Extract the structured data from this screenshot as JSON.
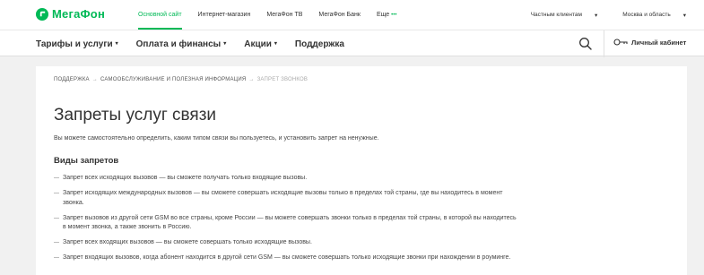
{
  "logo": {
    "text": "МегаФон"
  },
  "top_nav": {
    "items": [
      "Основной сайт",
      "Интернет-магазин",
      "МегаФон ТВ",
      "МегаФон Банк"
    ],
    "more_label": "Еще",
    "more_dots": "•••",
    "segment_label": "Частным клиентам",
    "region_label": "Москва и область"
  },
  "main_nav": {
    "items": [
      "Тарифы и услуги",
      "Оплата и финансы",
      "Акции",
      "Поддержка"
    ],
    "cabinet_label": "Личный кабинет"
  },
  "breadcrumb": {
    "items": [
      "ПОДДЕРЖКА",
      "САМООБСЛУЖИВАНИЕ И ПОЛЕЗНАЯ ИНФОРМАЦИЯ",
      "ЗАПРЕТ ЗВОНКОВ"
    ],
    "separator": "→"
  },
  "page": {
    "title": "Запреты услуг связи",
    "intro": "Вы можете самостоятельно определить, каким типом связи вы пользуетесь, и установить запрет на ненужные.",
    "subtitle": "Виды запретов",
    "list": [
      "Запрет всех исходящих вызовов — вы сможете получать только входящие вызовы.",
      "Запрет исходящих международных вызовов — вы сможете совершать исходящие вызовы только в пределах той страны, где вы находитесь в момент звонка.",
      "Запрет вызовов из другой сети GSM во все страны, кроме России — вы можете совершать звонки только в пределах той страны, в которой вы находитесь в момент звонка, а также звонить в Россию.",
      "Запрет всех входящих вызовов — вы сможете совершать только исходящие вызовы.",
      "Запрет входящих вызовов, когда абонент находится в другой сети GSM — вы сможете совершать только исходящие звонки при нахождении в роуминге."
    ]
  },
  "colors": {
    "brand": "#00b956",
    "text": "#333333",
    "background": "#f1f1f1"
  },
  "icons": {
    "logo": "megafon-logo-icon",
    "search": "search-icon",
    "cabinet": "key-icon",
    "caret": "chevron-down-icon"
  }
}
